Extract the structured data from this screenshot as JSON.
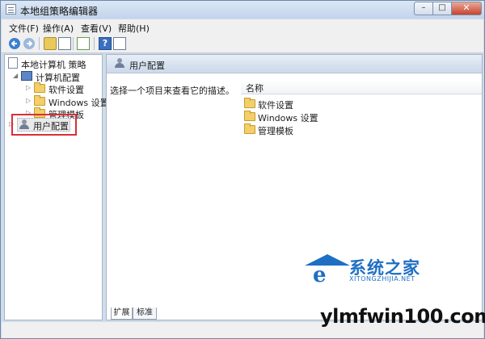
{
  "window": {
    "title": "本地组策略编辑器",
    "close_glyph": "✕",
    "max_glyph": "□",
    "min_glyph": "–"
  },
  "menubar": {
    "items": [
      "文件(F)",
      "操作(A)",
      "查看(V)",
      "帮助(H)"
    ]
  },
  "toolbar": {
    "icons": [
      "back-arrow-icon",
      "forward-arrow-icon",
      "up-folder-icon",
      "show-hide-tree-icon",
      "export-list-icon",
      "help-icon",
      "properties-icon"
    ],
    "help_glyph": "?"
  },
  "tree": {
    "root": "本地计算机 策略",
    "computer_config": "计算机配置",
    "computer_children": [
      "软件设置",
      "Windows 设置",
      "管理模板"
    ],
    "user_config": "用户配置"
  },
  "details": {
    "header_title": "用户配置",
    "description": "选择一个项目来查看它的描述。",
    "column_name": "名称",
    "items": [
      "软件设置",
      "Windows 设置",
      "管理模板"
    ]
  },
  "tabs": [
    "扩展",
    "标准"
  ],
  "watermark": {
    "brand_cn": "系统之家",
    "brand_pinyin": "XITONGZHIJIA.NET",
    "site": "ylmfwin100.com",
    "logo_letter": "e"
  },
  "colors": {
    "highlight_box": "#d7303a",
    "watermark_blue": "#1e6fc4",
    "window_chrome": "#cfdcec"
  }
}
